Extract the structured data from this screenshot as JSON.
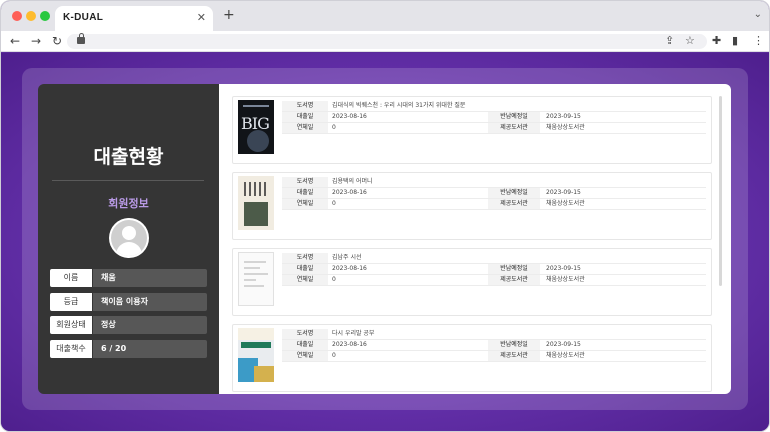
{
  "browser": {
    "tab_title": "K-DUAL",
    "tab_close": "✕",
    "new_tab": "+",
    "tabs_menu": "⌄",
    "nav": {
      "back": "←",
      "forward": "→",
      "reload": "↻"
    },
    "toolbar_icons": {
      "share": "⇪",
      "bookmark": "☆",
      "extensions": "✚",
      "sidebar": "▮",
      "menu": "⋮"
    }
  },
  "profile": {
    "title": "대출현황",
    "member_heading": "회원정보",
    "info": [
      {
        "label": "이름",
        "value": "채움"
      },
      {
        "label": "등급",
        "value": "책이음 이용자"
      },
      {
        "label": "회원상태",
        "value": "정상"
      },
      {
        "label": "대출책수",
        "value": "6 / 20"
      }
    ]
  },
  "labels": {
    "book_title": "도서명",
    "loan_date": "대출일",
    "due_date": "반납예정일",
    "overdue_days": "연체일",
    "library": "제공도서관"
  },
  "loans": [
    {
      "title": "김대식의 빅퀘스천 : 우리 시대의 31가지 위대한 질문",
      "loan_date": "2023-08-16",
      "due_date": "2023-09-15",
      "overdue": "0",
      "library": "채움상상도서관",
      "cover_text": "BIG"
    },
    {
      "title": "김용택의 어머니",
      "loan_date": "2023-08-16",
      "due_date": "2023-09-15",
      "overdue": "0",
      "library": "채움상상도서관"
    },
    {
      "title": "김남주 시선",
      "loan_date": "2023-08-16",
      "due_date": "2023-09-15",
      "overdue": "0",
      "library": "채움상상도서관"
    },
    {
      "title": "다시 우리말 공부",
      "loan_date": "2023-08-16",
      "due_date": "2023-09-15",
      "overdue": "0",
      "library": "채움상상도서관"
    }
  ]
}
